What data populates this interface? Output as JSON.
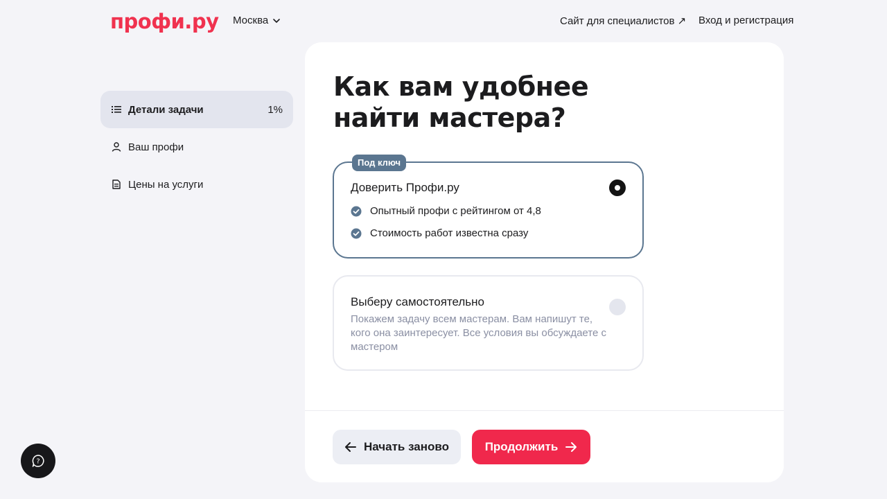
{
  "header": {
    "logo": "профи.ру",
    "city": "Москва",
    "specialists_link": "Сайт для специалистов ↗",
    "login_link": "Вход и регистрация"
  },
  "sidebar": {
    "items": [
      {
        "label": "Детали задачи",
        "percent": "1%",
        "icon": "list-icon",
        "active": true
      },
      {
        "label": "Ваш профи",
        "icon": "user-icon",
        "active": false
      },
      {
        "label": "Цены на услуги",
        "icon": "document-icon",
        "active": false
      }
    ]
  },
  "main": {
    "title": "Как вам удобнее найти мастера?",
    "options": [
      {
        "badge": "Под ключ",
        "title": "Доверить Профи.ру",
        "features": [
          "Опытный профи с рейтингом от 4,8",
          "Стоимость работ известна сразу"
        ],
        "selected": true
      },
      {
        "title": "Выберу самостоятельно",
        "description": "Покажем задачу всем мастерам. Вам напишут те, кого она заинтересует. Все условия вы обсуждаете с мастером",
        "selected": false
      }
    ],
    "buttons": {
      "restart": "Начать заново",
      "continue": "Продолжить"
    }
  },
  "colors": {
    "brand": "#f0324f",
    "accent": "#5b7690",
    "continue_button": "#f0284c"
  }
}
